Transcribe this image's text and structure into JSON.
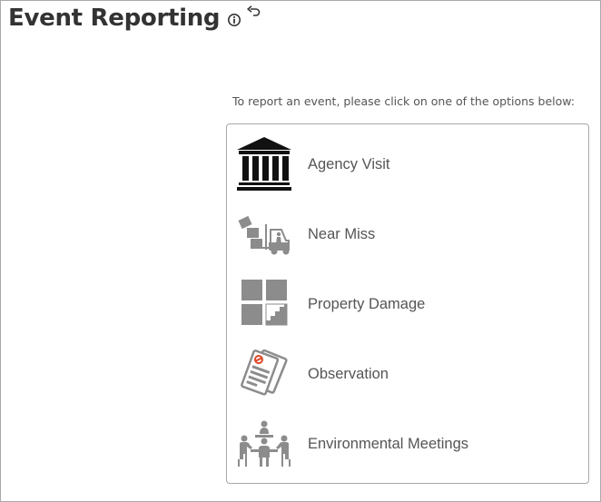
{
  "header": {
    "title": "Event Reporting",
    "info_icon": "info-circle-icon",
    "back_icon": "return-arrow-icon"
  },
  "instruction": "To report an event, please click on one of the options below:",
  "options": [
    {
      "label": "Agency Visit",
      "icon": "government-building-icon"
    },
    {
      "label": "Near Miss",
      "icon": "forklift-icon"
    },
    {
      "label": "Property Damage",
      "icon": "broken-window-icon"
    },
    {
      "label": "Observation",
      "icon": "documents-icon"
    },
    {
      "label": "Environmental Meetings",
      "icon": "meeting-table-icon"
    }
  ],
  "colors": {
    "icon_dark": "#111111",
    "icon_gray": "#8c8c8c",
    "accent_red": "#e04a2a",
    "border": "#a9a9a9",
    "text": "#555555"
  }
}
